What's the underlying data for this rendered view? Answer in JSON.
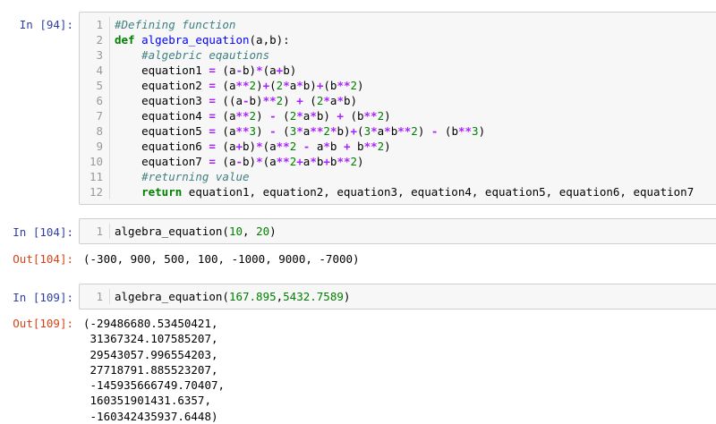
{
  "cells": [
    {
      "prompt": "In [94]:",
      "code_lines": [
        {
          "n": "1",
          "tokens": [
            {
              "t": "#Defining function",
              "c": "cmt"
            }
          ]
        },
        {
          "n": "2",
          "tokens": [
            {
              "t": "def",
              "c": "kw"
            },
            {
              "t": " "
            },
            {
              "t": "algebra_equation",
              "c": "fn"
            },
            {
              "t": "(a,b):"
            }
          ]
        },
        {
          "n": "3",
          "tokens": [
            {
              "t": "    "
            },
            {
              "t": "#algebric eqautions",
              "c": "cmt"
            }
          ]
        },
        {
          "n": "4",
          "tokens": [
            {
              "t": "    equation1 "
            },
            {
              "t": "=",
              "c": "op"
            },
            {
              "t": " (a"
            },
            {
              "t": "-",
              "c": "op"
            },
            {
              "t": "b)"
            },
            {
              "t": "*",
              "c": "op"
            },
            {
              "t": "(a"
            },
            {
              "t": "+",
              "c": "op"
            },
            {
              "t": "b)"
            }
          ]
        },
        {
          "n": "5",
          "tokens": [
            {
              "t": "    equation2 "
            },
            {
              "t": "=",
              "c": "op"
            },
            {
              "t": " (a"
            },
            {
              "t": "**",
              "c": "op"
            },
            {
              "t": "2",
              "c": "num"
            },
            {
              "t": ")"
            },
            {
              "t": "+",
              "c": "op"
            },
            {
              "t": "("
            },
            {
              "t": "2",
              "c": "num"
            },
            {
              "t": "*",
              "c": "op"
            },
            {
              "t": "a"
            },
            {
              "t": "*",
              "c": "op"
            },
            {
              "t": "b)"
            },
            {
              "t": "+",
              "c": "op"
            },
            {
              "t": "(b"
            },
            {
              "t": "**",
              "c": "op"
            },
            {
              "t": "2",
              "c": "num"
            },
            {
              "t": ")"
            }
          ]
        },
        {
          "n": "6",
          "tokens": [
            {
              "t": "    equation3 "
            },
            {
              "t": "=",
              "c": "op"
            },
            {
              "t": " ((a"
            },
            {
              "t": "-",
              "c": "op"
            },
            {
              "t": "b)"
            },
            {
              "t": "**",
              "c": "op"
            },
            {
              "t": "2",
              "c": "num"
            },
            {
              "t": ") "
            },
            {
              "t": "+",
              "c": "op"
            },
            {
              "t": " ("
            },
            {
              "t": "2",
              "c": "num"
            },
            {
              "t": "*",
              "c": "op"
            },
            {
              "t": "a"
            },
            {
              "t": "*",
              "c": "op"
            },
            {
              "t": "b)"
            }
          ]
        },
        {
          "n": "7",
          "tokens": [
            {
              "t": "    equation4 "
            },
            {
              "t": "=",
              "c": "op"
            },
            {
              "t": " (a"
            },
            {
              "t": "**",
              "c": "op"
            },
            {
              "t": "2",
              "c": "num"
            },
            {
              "t": ") "
            },
            {
              "t": "-",
              "c": "op"
            },
            {
              "t": " ("
            },
            {
              "t": "2",
              "c": "num"
            },
            {
              "t": "*",
              "c": "op"
            },
            {
              "t": "a"
            },
            {
              "t": "*",
              "c": "op"
            },
            {
              "t": "b) "
            },
            {
              "t": "+",
              "c": "op"
            },
            {
              "t": " (b"
            },
            {
              "t": "**",
              "c": "op"
            },
            {
              "t": "2",
              "c": "num"
            },
            {
              "t": ")"
            }
          ]
        },
        {
          "n": "8",
          "tokens": [
            {
              "t": "    equation5 "
            },
            {
              "t": "=",
              "c": "op"
            },
            {
              "t": " (a"
            },
            {
              "t": "**",
              "c": "op"
            },
            {
              "t": "3",
              "c": "num"
            },
            {
              "t": ") "
            },
            {
              "t": "-",
              "c": "op"
            },
            {
              "t": " ("
            },
            {
              "t": "3",
              "c": "num"
            },
            {
              "t": "*",
              "c": "op"
            },
            {
              "t": "a"
            },
            {
              "t": "**",
              "c": "op"
            },
            {
              "t": "2",
              "c": "num"
            },
            {
              "t": "*",
              "c": "op"
            },
            {
              "t": "b)"
            },
            {
              "t": "+",
              "c": "op"
            },
            {
              "t": "("
            },
            {
              "t": "3",
              "c": "num"
            },
            {
              "t": "*",
              "c": "op"
            },
            {
              "t": "a"
            },
            {
              "t": "*",
              "c": "op"
            },
            {
              "t": "b"
            },
            {
              "t": "**",
              "c": "op"
            },
            {
              "t": "2",
              "c": "num"
            },
            {
              "t": ") "
            },
            {
              "t": "-",
              "c": "op"
            },
            {
              "t": " (b"
            },
            {
              "t": "**",
              "c": "op"
            },
            {
              "t": "3",
              "c": "num"
            },
            {
              "t": ")"
            }
          ]
        },
        {
          "n": "9",
          "tokens": [
            {
              "t": "    equation6 "
            },
            {
              "t": "=",
              "c": "op"
            },
            {
              "t": " (a"
            },
            {
              "t": "+",
              "c": "op"
            },
            {
              "t": "b)"
            },
            {
              "t": "*",
              "c": "op"
            },
            {
              "t": "(a"
            },
            {
              "t": "**",
              "c": "op"
            },
            {
              "t": "2",
              "c": "num"
            },
            {
              "t": " "
            },
            {
              "t": "-",
              "c": "op"
            },
            {
              "t": " a"
            },
            {
              "t": "*",
              "c": "op"
            },
            {
              "t": "b "
            },
            {
              "t": "+",
              "c": "op"
            },
            {
              "t": " b"
            },
            {
              "t": "**",
              "c": "op"
            },
            {
              "t": "2",
              "c": "num"
            },
            {
              "t": ")"
            }
          ]
        },
        {
          "n": "10",
          "tokens": [
            {
              "t": "    equation7 "
            },
            {
              "t": "=",
              "c": "op"
            },
            {
              "t": " (a"
            },
            {
              "t": "-",
              "c": "op"
            },
            {
              "t": "b)"
            },
            {
              "t": "*",
              "c": "op"
            },
            {
              "t": "(a"
            },
            {
              "t": "**",
              "c": "op"
            },
            {
              "t": "2",
              "c": "num"
            },
            {
              "t": "+",
              "c": "op"
            },
            {
              "t": "a"
            },
            {
              "t": "*",
              "c": "op"
            },
            {
              "t": "b"
            },
            {
              "t": "+",
              "c": "op"
            },
            {
              "t": "b"
            },
            {
              "t": "**",
              "c": "op"
            },
            {
              "t": "2",
              "c": "num"
            },
            {
              "t": ")"
            }
          ]
        },
        {
          "n": "11",
          "tokens": [
            {
              "t": "    "
            },
            {
              "t": "#returning value",
              "c": "cmt"
            }
          ]
        },
        {
          "n": "12",
          "tokens": [
            {
              "t": "    "
            },
            {
              "t": "return",
              "c": "kw"
            },
            {
              "t": " equation1, equation2, equation3, equation4, equation5, equation6, equation7"
            }
          ]
        }
      ]
    },
    {
      "prompt": "In [104]:",
      "code_lines": [
        {
          "n": "1",
          "tokens": [
            {
              "t": "algebra_equation("
            },
            {
              "t": "10",
              "c": "num"
            },
            {
              "t": ", "
            },
            {
              "t": "20",
              "c": "num"
            },
            {
              "t": ")"
            }
          ]
        }
      ],
      "out_prompt": "Out[104]:",
      "output_lines": [
        "(-300, 900, 500, 100, -1000, 9000, -7000)"
      ]
    },
    {
      "prompt": "In [109]:",
      "code_lines": [
        {
          "n": "1",
          "tokens": [
            {
              "t": "algebra_equation("
            },
            {
              "t": "167.895",
              "c": "num"
            },
            {
              "t": ","
            },
            {
              "t": "5432.7589",
              "c": "num"
            },
            {
              "t": ")"
            }
          ]
        }
      ],
      "out_prompt": "Out[109]:",
      "output_lines": [
        "(-29486680.53450421,",
        " 31367324.107585207,",
        " 29543057.996554203,",
        " 27718791.885523207,",
        " -145935666749.70407,",
        " 160351901431.6357,",
        " -160342435937.6448)"
      ]
    }
  ]
}
